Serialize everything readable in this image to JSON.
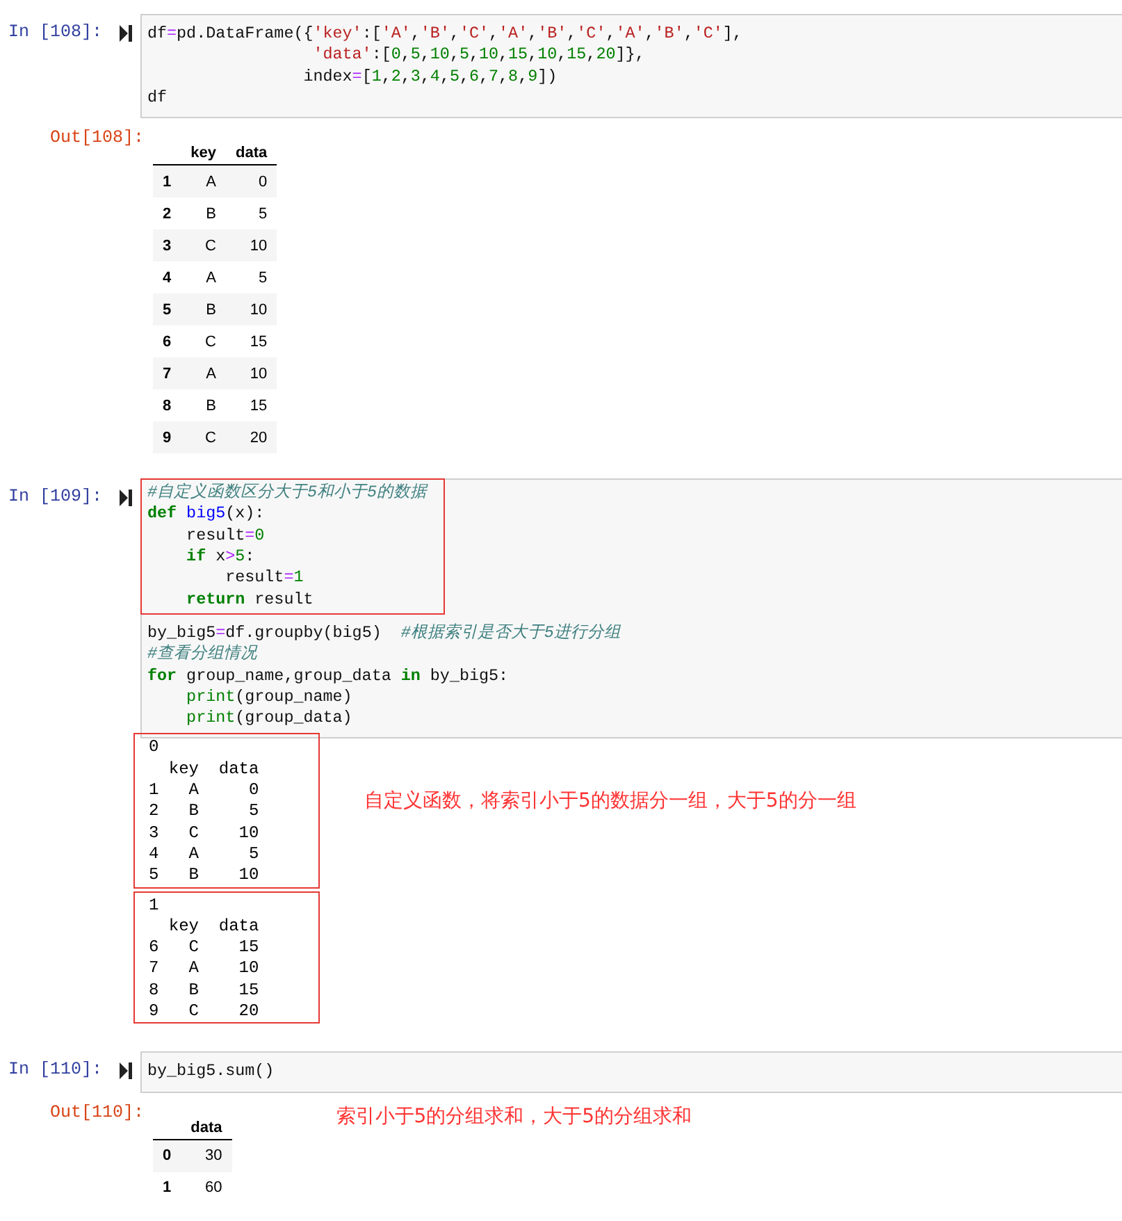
{
  "cells": [
    {
      "prompt": "In [108]:",
      "blocks": [
        {
          "boxed": false,
          "lines": [
            [
              {
                "plain": "df"
              },
              {
                "operator": "="
              },
              {
                "plain": "pd.DataFrame({"
              },
              {
                "string": "'key'"
              },
              {
                "plain": ":["
              },
              {
                "string": "'A'"
              },
              {
                "plain": ","
              },
              {
                "string": "'B'"
              },
              {
                "plain": ","
              },
              {
                "string": "'C'"
              },
              {
                "plain": ","
              },
              {
                "string": "'A'"
              },
              {
                "plain": ","
              },
              {
                "string": "'B'"
              },
              {
                "plain": ","
              },
              {
                "string": "'C'"
              },
              {
                "plain": ","
              },
              {
                "string": "'A'"
              },
              {
                "plain": ","
              },
              {
                "string": "'B'"
              },
              {
                "plain": ","
              },
              {
                "string": "'C'"
              },
              {
                "plain": "],"
              }
            ],
            [
              {
                "string": "                 'data'"
              },
              {
                "plain": ":["
              },
              {
                "number": "0"
              },
              {
                "plain": ","
              },
              {
                "number": "5"
              },
              {
                "plain": ","
              },
              {
                "number": "10"
              },
              {
                "plain": ","
              },
              {
                "number": "5"
              },
              {
                "plain": ","
              },
              {
                "number": "10"
              },
              {
                "plain": ","
              },
              {
                "number": "15"
              },
              {
                "plain": ","
              },
              {
                "number": "10"
              },
              {
                "plain": ","
              },
              {
                "number": "15"
              },
              {
                "plain": ","
              },
              {
                "number": "20"
              },
              {
                "plain": "]},"
              }
            ],
            [
              {
                "plain": "                index"
              },
              {
                "operator": "="
              },
              {
                "plain": "["
              },
              {
                "number": "1"
              },
              {
                "plain": ","
              },
              {
                "number": "2"
              },
              {
                "plain": ","
              },
              {
                "number": "3"
              },
              {
                "plain": ","
              },
              {
                "number": "4"
              },
              {
                "plain": ","
              },
              {
                "number": "5"
              },
              {
                "plain": ","
              },
              {
                "number": "6"
              },
              {
                "plain": ","
              },
              {
                "number": "7"
              },
              {
                "plain": ","
              },
              {
                "number": "8"
              },
              {
                "plain": ","
              },
              {
                "number": "9"
              },
              {
                "plain": "])"
              }
            ],
            [
              {
                "plain": "df"
              }
            ]
          ]
        }
      ],
      "output": {
        "prompt": "Out[108]:",
        "kind": "table",
        "columns": [
          "key",
          "data"
        ],
        "rows": [
          {
            "index": "1",
            "cells": [
              "A",
              "0"
            ]
          },
          {
            "index": "2",
            "cells": [
              "B",
              "5"
            ]
          },
          {
            "index": "3",
            "cells": [
              "C",
              "10"
            ]
          },
          {
            "index": "4",
            "cells": [
              "A",
              "5"
            ]
          },
          {
            "index": "5",
            "cells": [
              "B",
              "10"
            ]
          },
          {
            "index": "6",
            "cells": [
              "C",
              "15"
            ]
          },
          {
            "index": "7",
            "cells": [
              "A",
              "10"
            ]
          },
          {
            "index": "8",
            "cells": [
              "B",
              "15"
            ]
          },
          {
            "index": "9",
            "cells": [
              "C",
              "20"
            ]
          }
        ]
      }
    },
    {
      "prompt": "In [109]:",
      "blocks": [
        {
          "boxed": true,
          "lines": [
            [
              {
                "comment": "#自定义函数区分大于5和小于5的数据"
              }
            ],
            [
              {
                "keyword": "def"
              },
              {
                "function": " big5"
              },
              {
                "plain": "(x):"
              }
            ],
            [
              {
                "plain": "    result"
              },
              {
                "operator": "="
              },
              {
                "number": "0"
              }
            ],
            [
              {
                "keyword": "    if"
              },
              {
                "plain": " x"
              },
              {
                "operator": ">"
              },
              {
                "number": "5"
              },
              {
                "plain": ":"
              }
            ],
            [
              {
                "plain": "        result"
              },
              {
                "operator": "="
              },
              {
                "number": "1"
              }
            ],
            [
              {
                "keyword": "    return"
              },
              {
                "plain": " result"
              }
            ]
          ]
        },
        {
          "boxed": false,
          "lines": [
            [
              {
                "plain": "by_big5"
              },
              {
                "operator": "="
              },
              {
                "plain": "df.groupby(big5)  "
              },
              {
                "comment": "#根据索引是否大于5进行分组"
              }
            ],
            [
              {
                "comment": "#查看分组情况"
              }
            ],
            [
              {
                "keyword": "for"
              },
              {
                "plain": " group_name,group_data "
              },
              {
                "keyword": "in"
              },
              {
                "plain": " by_big5:"
              }
            ],
            [
              {
                "builtin": "    print"
              },
              {
                "plain": "(group_name)"
              }
            ],
            [
              {
                "builtin": "    print"
              },
              {
                "plain": "(group_data)"
              }
            ]
          ]
        }
      ],
      "output": {
        "kind": "stream",
        "groups": [
          {
            "boxed": true,
            "lines": [
              "0",
              "  key  data",
              "1   A     0",
              "2   B     5",
              "3   C    10",
              "4   A     5",
              "5   B    10"
            ]
          },
          {
            "boxed": true,
            "lines": [
              "1",
              "  key  data",
              "6   C    15",
              "7   A    10",
              "8   B    15",
              "9   C    20"
            ]
          }
        ],
        "annotation": "自定义函数，将索引小于5的数据分一组，大于5的分一组"
      }
    },
    {
      "prompt": "In [110]:",
      "blocks": [
        {
          "boxed": false,
          "lines": [
            [
              {
                "plain": "by_big5.sum()"
              }
            ]
          ]
        }
      ],
      "output": {
        "prompt": "Out[110]:",
        "kind": "table",
        "columns": [
          "data"
        ],
        "rows": [
          {
            "index": "0",
            "cells": [
              "30"
            ]
          },
          {
            "index": "1",
            "cells": [
              "60"
            ]
          }
        ],
        "annotation": "索引小于5的分组求和，大于5的分组求和"
      }
    }
  ]
}
